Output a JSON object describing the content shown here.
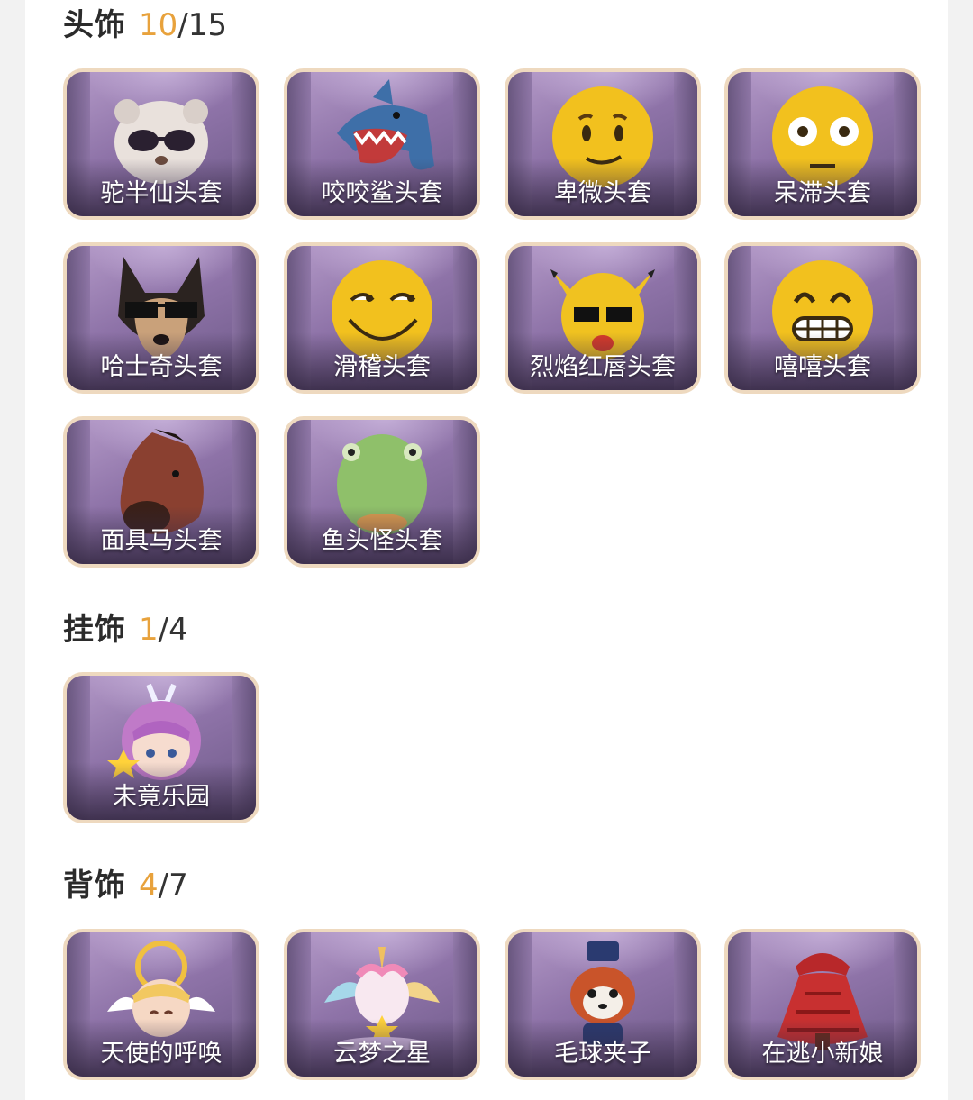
{
  "sections": [
    {
      "title": "头饰",
      "count_current": "10",
      "count_sep": "/",
      "count_total": "15",
      "items": [
        {
          "label": "驼半仙头套",
          "icon": "raccoon-sunglasses-head"
        },
        {
          "label": "咬咬鲨头套",
          "icon": "shark-head"
        },
        {
          "label": "卑微头套",
          "icon": "humble-emoji-head"
        },
        {
          "label": "呆滞头套",
          "icon": "dazed-emoji-head"
        },
        {
          "label": "哈士奇头套",
          "icon": "husky-sunglasses-head"
        },
        {
          "label": "滑稽头套",
          "icon": "funny-emoji-head"
        },
        {
          "label": "烈焰红唇头套",
          "icon": "yellow-mascot-sunglasses-head"
        },
        {
          "label": "嘻嘻头套",
          "icon": "grin-emoji-head"
        },
        {
          "label": "面具马头套",
          "icon": "horse-mask-head"
        },
        {
          "label": "鱼头怪头套",
          "icon": "fish-head"
        }
      ]
    },
    {
      "title": "挂饰",
      "count_current": "1",
      "count_sep": "/",
      "count_total": "4",
      "items": [
        {
          "label": "未竟乐园",
          "icon": "chibi-girl-charm"
        }
      ]
    },
    {
      "title": "背饰",
      "count_current": "4",
      "count_sep": "/",
      "count_total": "7",
      "items": [
        {
          "label": "天使的呼唤",
          "icon": "angel-back"
        },
        {
          "label": "云梦之星",
          "icon": "unicorn-back"
        },
        {
          "label": "毛球夹子",
          "icon": "red-panda-back"
        },
        {
          "label": "在逃小新娘",
          "icon": "red-dress-back"
        }
      ]
    }
  ],
  "colors": {
    "accent_count": "#e8a23c",
    "card_border": "#eed9bf",
    "card_bg": "#8e73a8",
    "page_bg": "#ffffff"
  }
}
